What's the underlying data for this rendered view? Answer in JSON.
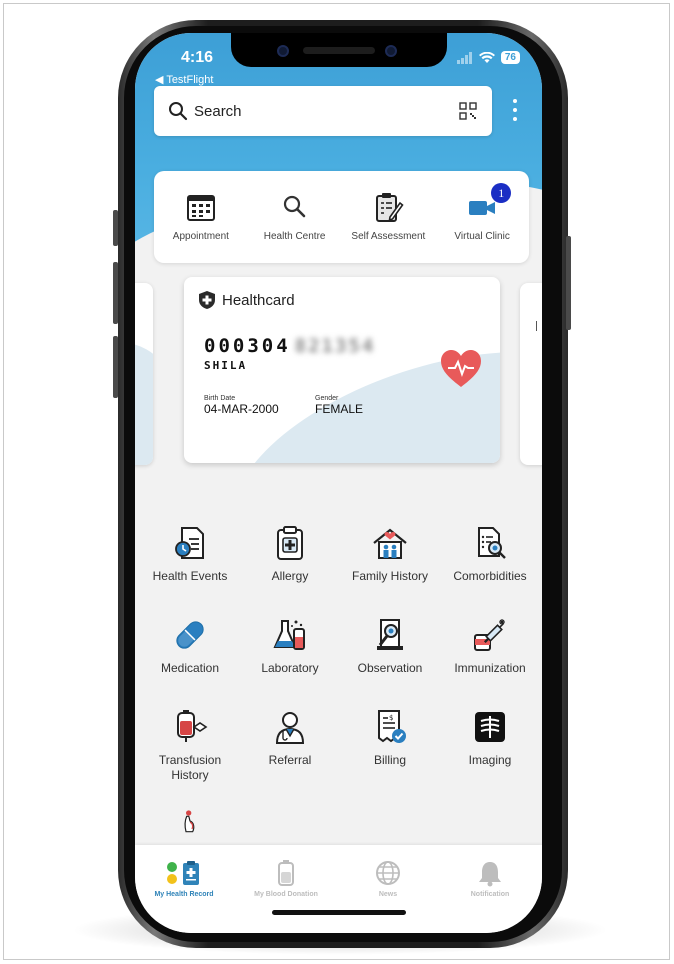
{
  "status_bar": {
    "time": "4:16",
    "back_label": "◀ TestFlight",
    "battery": "76"
  },
  "search": {
    "placeholder": "Search"
  },
  "quick_actions": [
    {
      "label": "Appointment",
      "icon": "calendar-icon"
    },
    {
      "label": "Health Centre",
      "icon": "search-icon"
    },
    {
      "label": "Self Assessment",
      "icon": "clipboard-pen-icon"
    },
    {
      "label": "Virtual Clinic",
      "icon": "video-camera-icon",
      "badge": "1"
    }
  ],
  "health_card": {
    "title": "Healthcard",
    "number_visible": "000304",
    "number_redacted": "821354",
    "name": "SHILA",
    "birth_date_label": "Birth Date",
    "birth_date": "04-MAR-2000",
    "gender_label": "Gender",
    "gender": "FEMALE"
  },
  "menu": [
    {
      "label": "Health Events",
      "icon": "document-clock-icon"
    },
    {
      "label": "Allergy",
      "icon": "medical-clipboard-icon"
    },
    {
      "label": "Family History",
      "icon": "family-house-icon"
    },
    {
      "label": "Comorbidities",
      "icon": "document-magnifier-icon"
    },
    {
      "label": "Medication",
      "icon": "capsule-icon"
    },
    {
      "label": "Laboratory",
      "icon": "lab-flask-icon"
    },
    {
      "label": "Observation",
      "icon": "observation-magnifier-icon"
    },
    {
      "label": "Immunization",
      "icon": "syringe-icon"
    },
    {
      "label": "Transfusion History",
      "icon": "blood-bag-icon"
    },
    {
      "label": "Referral",
      "icon": "doctor-icon"
    },
    {
      "label": "Billing",
      "icon": "bill-check-icon"
    },
    {
      "label": "Imaging",
      "icon": "xray-icon"
    },
    {
      "label": "",
      "icon": "pregnancy-icon"
    }
  ],
  "bottom_nav": [
    {
      "label": "My Health Record",
      "icon": "health-record-icon",
      "active": true
    },
    {
      "label": "My Blood Donation",
      "icon": "blood-bag-nav-icon",
      "active": false
    },
    {
      "label": "News",
      "icon": "globe-icon",
      "active": false
    },
    {
      "label": "Notification",
      "icon": "bell-icon",
      "active": false
    }
  ],
  "colors": {
    "accent": "#3d9fd6",
    "badge": "#1b2ec4",
    "nav_active": "#2f83b8"
  }
}
